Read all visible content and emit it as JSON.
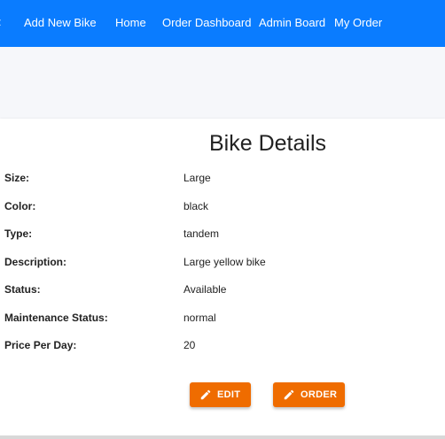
{
  "nav": {
    "items": [
      {
        "label": "Add New Bike"
      },
      {
        "label": "Home"
      },
      {
        "label": "Order Dashboard"
      },
      {
        "label": "Admin Board"
      },
      {
        "label": "My Order"
      }
    ]
  },
  "details": {
    "title": "Bike Details",
    "rows": [
      {
        "label": "Size:",
        "value": "Large"
      },
      {
        "label": "Color:",
        "value": "black"
      },
      {
        "label": "Type:",
        "value": "tandem"
      },
      {
        "label": "Description:",
        "value": "Large yellow bike"
      },
      {
        "label": "Status:",
        "value": "Available"
      },
      {
        "label": "Maintenance Status:",
        "value": "normal"
      },
      {
        "label": "Price Per Day:",
        "value": "20"
      }
    ]
  },
  "actions": {
    "edit_label": "EDIT",
    "order_label": "ORDER",
    "edit_icon": "pencil-icon",
    "order_icon": "pencil-icon"
  },
  "colors": {
    "navbar": "#0a7cff",
    "button": "#ef6c00"
  }
}
